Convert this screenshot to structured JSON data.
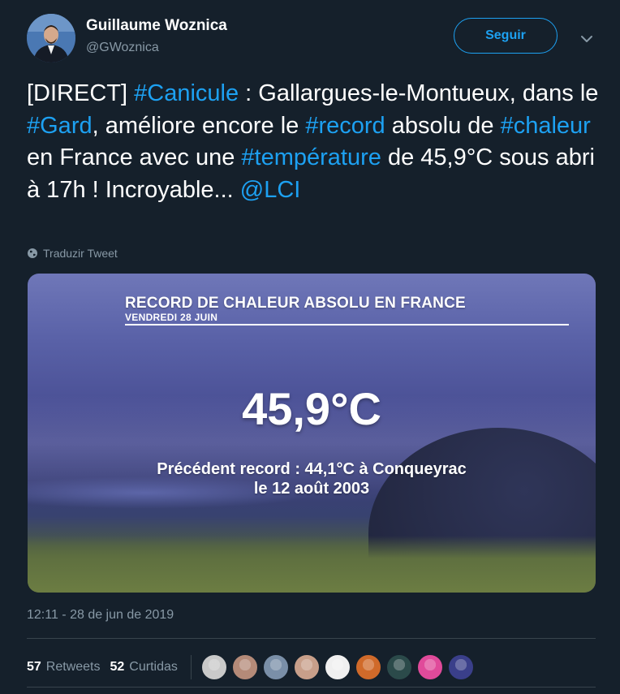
{
  "author": {
    "display_name": "Guillaume Woznica",
    "handle": "@GWoznica"
  },
  "follow_button": {
    "label": "Seguir"
  },
  "tweet": {
    "segments": [
      {
        "text": "[DIRECT] ",
        "tag": false
      },
      {
        "text": "#Canicule",
        "tag": true
      },
      {
        "text": " : Gallargues-le-Montueux, dans le ",
        "tag": false
      },
      {
        "text": "#Gard",
        "tag": true
      },
      {
        "text": ", améliore encore le ",
        "tag": false
      },
      {
        "text": "#record",
        "tag": true
      },
      {
        "text": " absolu de ",
        "tag": false
      },
      {
        "text": "#chaleur",
        "tag": true
      },
      {
        "text": " en France avec une ",
        "tag": false
      },
      {
        "text": "#température",
        "tag": true
      },
      {
        "text": " de 45,9°C sous abri à 17h ! Incroyable... ",
        "tag": false
      },
      {
        "text": "@LCI",
        "tag": true
      }
    ],
    "translate_label": "Traduzir Tweet",
    "timestamp": "12:11 - 28 de jun de 2019"
  },
  "media": {
    "title": "RECORD DE CHALEUR ABSOLU EN FRANCE",
    "date": "VENDREDI 28 JUIN",
    "value": "45,9°C",
    "sub_line1": "Précédent record : 44,1°C à Conqueyrac",
    "sub_line2": "le 12 août 2003"
  },
  "stats": {
    "retweets_count": "57",
    "retweets_label": "Retweets",
    "likes_count": "52",
    "likes_label": "Curtidas"
  },
  "likers": [
    {
      "color": "#c9c9c9",
      "icon": "user-avatar"
    },
    {
      "color": "#b48a78",
      "icon": "user-avatar"
    },
    {
      "color": "#7a8fa8",
      "icon": "user-avatar"
    },
    {
      "color": "#c89f8a",
      "icon": "user-avatar"
    },
    {
      "color": "#f0f0f0",
      "icon": "user-avatar"
    },
    {
      "color": "#d06a2a",
      "icon": "user-avatar"
    },
    {
      "color": "#2b4a4a",
      "icon": "user-avatar"
    },
    {
      "color": "#e04a9a",
      "icon": "user-avatar"
    },
    {
      "color": "#3a3f8a",
      "icon": "user-avatar"
    }
  ],
  "colors": {
    "background": "#15202b",
    "accent": "#1da1f2",
    "secondary_text": "#8899a6",
    "divider": "#38444d"
  }
}
